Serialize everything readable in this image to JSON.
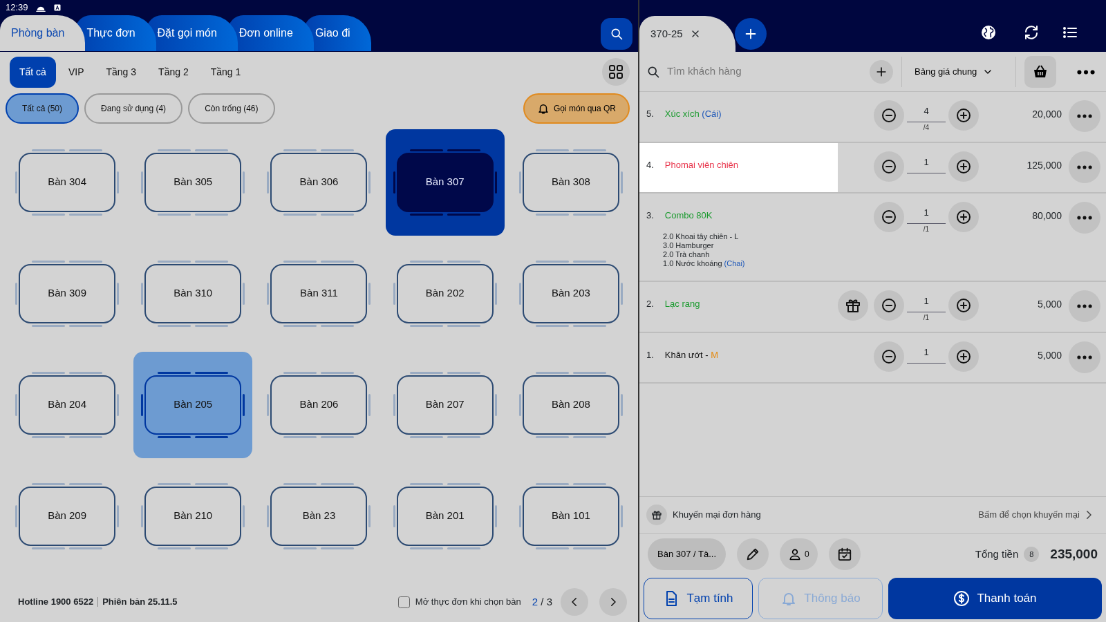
{
  "status_bar": {
    "time": "12:39"
  },
  "nav_tabs": [
    {
      "label": "Phòng bàn",
      "selected": true
    },
    {
      "label": "Thực đơn",
      "selected": false
    },
    {
      "label": "Đặt gọi món",
      "selected": false
    },
    {
      "label": "Đơn online",
      "selected": false
    },
    {
      "label": "Giao đi",
      "selected": false
    }
  ],
  "floor_tabs": [
    {
      "label": "Tất cả",
      "selected": true
    },
    {
      "label": "VIP",
      "selected": false
    },
    {
      "label": "Tầng 3",
      "selected": false
    },
    {
      "label": "Tầng 2",
      "selected": false
    },
    {
      "label": "Tầng 1",
      "selected": false
    }
  ],
  "filters": [
    {
      "label": "Tất cả (50)",
      "selected": true
    },
    {
      "label": "Đang sử dụng (4)",
      "selected": false
    },
    {
      "label": "Còn trống (46)",
      "selected": false
    }
  ],
  "qr_button": {
    "label": "Gọi món qua QR"
  },
  "tables": [
    {
      "label": "Bàn 304",
      "selected": false,
      "highlighted": false
    },
    {
      "label": "Bàn 305",
      "selected": false,
      "highlighted": false
    },
    {
      "label": "Bàn 306",
      "selected": false,
      "highlighted": false
    },
    {
      "label": "Bàn 307",
      "selected": true,
      "highlighted": false
    },
    {
      "label": "Bàn 308",
      "selected": false,
      "highlighted": false
    },
    {
      "label": "Bàn 309",
      "selected": false,
      "highlighted": false
    },
    {
      "label": "Bàn 310",
      "selected": false,
      "highlighted": false
    },
    {
      "label": "Bàn 311",
      "selected": false,
      "highlighted": false
    },
    {
      "label": "Bàn 202",
      "selected": false,
      "highlighted": false
    },
    {
      "label": "Bàn 203",
      "selected": false,
      "highlighted": false
    },
    {
      "label": "Bàn 204",
      "selected": false,
      "highlighted": false
    },
    {
      "label": "Bàn 205",
      "selected": false,
      "highlighted": true
    },
    {
      "label": "Bàn 206",
      "selected": false,
      "highlighted": false
    },
    {
      "label": "Bàn 207",
      "selected": false,
      "highlighted": false
    },
    {
      "label": "Bàn 208",
      "selected": false,
      "highlighted": false
    },
    {
      "label": "Bàn 209",
      "selected": false,
      "highlighted": false
    },
    {
      "label": "Bàn 210",
      "selected": false,
      "highlighted": false
    },
    {
      "label": "Bàn 23",
      "selected": false,
      "highlighted": false
    },
    {
      "label": "Bàn 201",
      "selected": false,
      "highlighted": false
    },
    {
      "label": "Bàn 101",
      "selected": false,
      "highlighted": false
    }
  ],
  "footer": {
    "hotline": "Hotline 1900 6522",
    "version": "Phiên bản 25.11.5",
    "open_menu": {
      "label": "Mở thực đơn khi chọn bàn",
      "checked": false
    },
    "page": "2",
    "pages": "/ 3"
  },
  "order_tab": {
    "label": "370-25"
  },
  "customer_search": {
    "placeholder": "Tìm khách hàng"
  },
  "price_list": {
    "value": "Bảng giá chung"
  },
  "items": [
    {
      "index": "5.",
      "name": "Xúc xích",
      "unit": "(Cái)",
      "color": "#1a9a2e",
      "gift": false,
      "quantity": "4",
      "limit": "/4",
      "price": "20,000",
      "selected": false
    },
    {
      "index": "4.",
      "name": "Phomai viên chiên",
      "color": "#e8334a",
      "gift": false,
      "quantity": "1",
      "price": "125,000",
      "selected": true
    },
    {
      "index": "3.",
      "name": "Combo 80K",
      "color": "#1a9a2e",
      "gift": false,
      "quantity": "1",
      "limit": "/1",
      "price": "80,000",
      "selected": false,
      "components": [
        {
          "text": "2.0 Khoai tây chiên - L"
        },
        {
          "text": "3.0 Hamburger"
        },
        {
          "text": "2.0 Trà chanh"
        },
        {
          "text": "1.0 Nước khoáng",
          "unit": "(Chai)"
        }
      ]
    },
    {
      "index": "2.",
      "name": "Lạc rang",
      "color": "#1a9a2e",
      "gift": true,
      "quantity": "1",
      "limit": "/1",
      "price": "5,000",
      "selected": false
    },
    {
      "index": "1.",
      "name": "Khăn ướt -",
      "variant": "M",
      "color": "#111111",
      "gift": false,
      "quantity": "1",
      "price": "5,000",
      "selected": false
    }
  ],
  "promo": {
    "label": "Khuyến mại đơn hàng",
    "hint": "Bấm để chọn khuyến mại"
  },
  "info": {
    "table": "Bàn 307 / Tà...",
    "guests": "0",
    "total_label": "Tổng tiền",
    "total_count": "8",
    "total": "235,000"
  },
  "actions": [
    {
      "label": "Tạm tính",
      "kind": "draft",
      "disabled": false
    },
    {
      "label": "Thông báo",
      "kind": "notify",
      "disabled": true
    },
    {
      "label": "Thanh toán",
      "kind": "pay",
      "disabled": false
    }
  ]
}
